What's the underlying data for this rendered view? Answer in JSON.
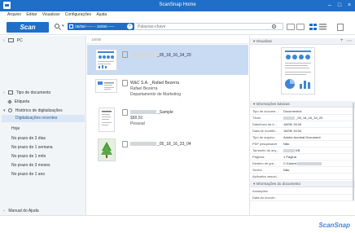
{
  "window": {
    "title": "ScanSnap Home"
  },
  "menu": [
    "Arquivo",
    "Editar",
    "Visualizar",
    "Configurações",
    "Ajuda"
  ],
  "toolbar": {
    "scan_label": "Scan",
    "date_range": "05/05/—— – 18/05/——",
    "keyword_placeholder": "Palavras-chave"
  },
  "sidebar": {
    "pc": "PC",
    "doc_type": "Tipo de documento",
    "tag": "Etiqueta",
    "history": "Histórico de digitalizações",
    "recent": "Digitalizações recentes",
    "items": [
      "Hoje",
      "No prazo de 3 dias",
      "No prazo de 1 semana",
      "No prazo de 1 mês",
      "No prazo de 3 meses",
      "No prazo de 1 ano"
    ],
    "help": "Manual do Ajuda"
  },
  "list": {
    "header": "18/05/",
    "docs": [
      {
        "title": "_05_18_16_34_20"
      },
      {
        "title": "W&C S.A. _Rafael Bezerra",
        "line1": "Rafael Bezerra",
        "line2": "Departamento de Marketing"
      },
      {
        "title": "_Sample",
        "line1": "$88,50",
        "line2": "Pessoal"
      },
      {
        "title": "_05_18_16_33_04"
      }
    ]
  },
  "preview": {
    "view_label": "Visualizar",
    "info_head": "Informações básicas",
    "rows": [
      {
        "k": "Tipo de docume...",
        "v": "Documentos"
      },
      {
        "k": "Título",
        "v": "_05_18_16_34_20"
      },
      {
        "k": "Data/hora da d...",
        "v": "18/05/      16:34"
      },
      {
        "k": "Data de modific...",
        "v": "18/05/      16:34"
      },
      {
        "k": "Tipo de arquivo",
        "v": "Adobe Acrobat Document"
      },
      {
        "k": "PDF pesquisável",
        "v": "Não"
      },
      {
        "k": "Tamanho do arq...",
        "v": "KB"
      },
      {
        "k": "Páginas",
        "v": "1 Página"
      },
      {
        "k": "Destino de gra...",
        "v": "C:\\Users\\"
      },
      {
        "k": "Senha",
        "v": "Não"
      },
      {
        "k": "Aplicativo associ...",
        "v": ""
      }
    ],
    "doc_info_head": "Informações do documento",
    "doc_rows": [
      {
        "k": "Anotações",
        "v": ""
      },
      {
        "k": "Data do docum...",
        "v": ""
      }
    ]
  },
  "brand": "ScanSnap",
  "colors": {
    "accent": "#1f6fc8",
    "selection": "#c9dbf3"
  }
}
